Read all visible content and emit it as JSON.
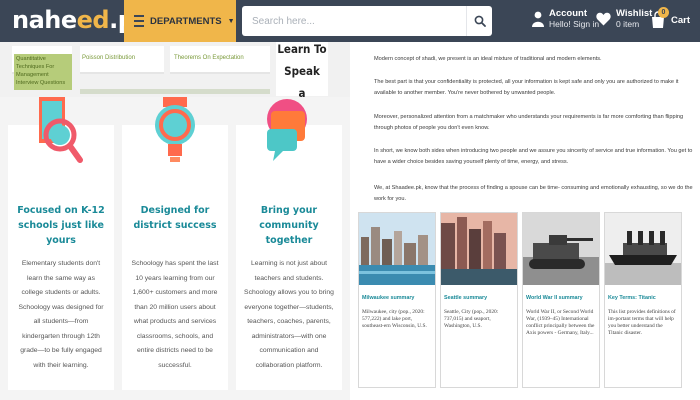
{
  "header": {
    "logo_main": "nahe",
    "logo_accent": "ed",
    "logo_tld": ".pk",
    "departments_label": "DEPARTMENTS",
    "search_placeholder": "Search here...",
    "account_title": "Account",
    "account_sub": "Hello! Sign in",
    "wishlist_title": "Wishlist",
    "wishlist_sub": "0 item",
    "cart_label": "Cart",
    "cart_count": "0",
    "accent_color": "#f0b64a",
    "bar_color": "#3b4656"
  },
  "course_strip": {
    "course_label": "Quantitative Techniques For Management Interview Questions",
    "links": [
      "Poisson Distribution",
      "Theorems On Expectation"
    ],
    "lang_card_lines": [
      "Learn To Speak",
      "a Language"
    ]
  },
  "features": [
    {
      "icon": "magnifier-tablet-icon",
      "title": "Focused on K-12 schools just like yours",
      "body": "Elementary students don't learn the same way as college students or adults. Schoology was designed for all students—from kindergarten through 12th grade—to be fully engaged with their learning."
    },
    {
      "icon": "lightbulb-icon",
      "title": "Designed for district success",
      "body": "Schoology has spent the last 10 years learning from our 1,600+ customers and more than 20 million users about what products and services classrooms, schools, and entire districts need to be successful."
    },
    {
      "icon": "chat-bubble-icon",
      "title": "Bring your community together",
      "body": "Learning is not just about teachers and students. Schoology allows you to bring everyone together—students, teachers, coaches, parents, administrators—with one communication and collaboration platform."
    }
  ],
  "article": {
    "paragraphs": [
      "Modern concept of shadi, we present is an ideal mixture of traditional and modern elements.",
      "The best part is that your confidentiality is protected, all your information is kept safe and only you are authorized to make it available to another member. You're never bothered by unwanted people.",
      "Moreover, personalized attention from a matchmaker who understands your requirements is far more comforting than flipping through photos of people you don't even know.",
      "In short, we know both sides when introducing two people and we assure you sincerity of service and true information. You get to have a wider choice besides saving yourself plenty of time, energy, and stress.",
      "We, at Shaadee.pk, know that the process of finding a spouse can be time- consuming and emotionally exhausting, so we do the work for you."
    ],
    "cards": [
      {
        "title": "Milwaukee summary",
        "desc": "Milwaukee, city (pop., 2020: 577,222) and lake port, southeast-ern Wisconsin, U.S."
      },
      {
        "title": "Seattle summary",
        "desc": "Seattle, City (pop., 2020: 737,015) and seaport, Washington, U.S."
      },
      {
        "title": "World War II summary",
        "desc": "World War II, or Second World War, (1939–45) International conflict principally between the Axis powers - Germany, Italy..."
      },
      {
        "title": "Key Terms: Titanic",
        "desc": "This list provides definitions of im-portant terms that will help you better understand the Titanic disaster."
      }
    ]
  }
}
